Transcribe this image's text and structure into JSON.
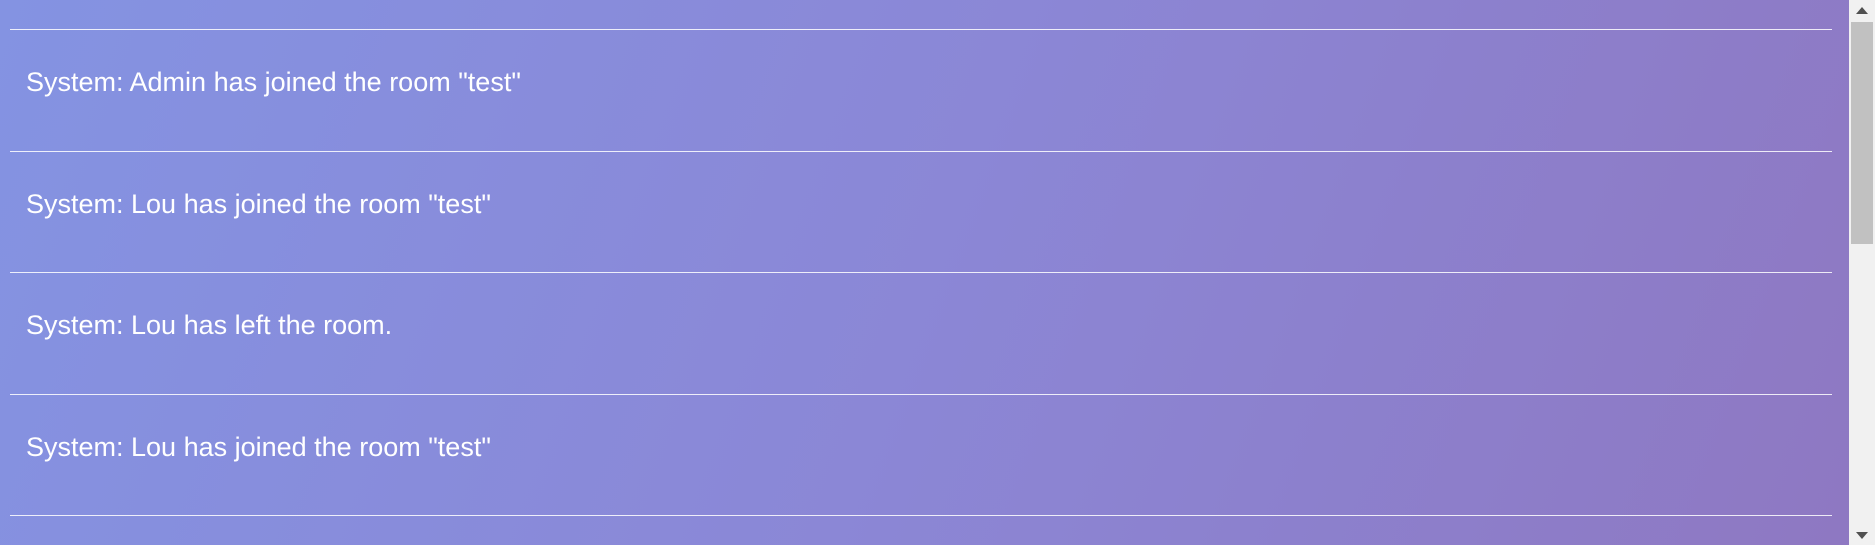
{
  "chat": {
    "messages": [
      {
        "text": "System: Admin has joined the room \"test\""
      },
      {
        "text": "System: Lou has joined the room \"test\""
      },
      {
        "text": "System: Lou has left the room."
      },
      {
        "text": "System: Lou has joined the room \"test\""
      }
    ]
  },
  "scrollbar": {
    "up_icon": "triangle-up-icon",
    "down_icon": "triangle-down-icon"
  },
  "colors": {
    "gradient_start": "#8493e2",
    "gradient_end": "#8e78c2",
    "text": "#ffffff"
  }
}
